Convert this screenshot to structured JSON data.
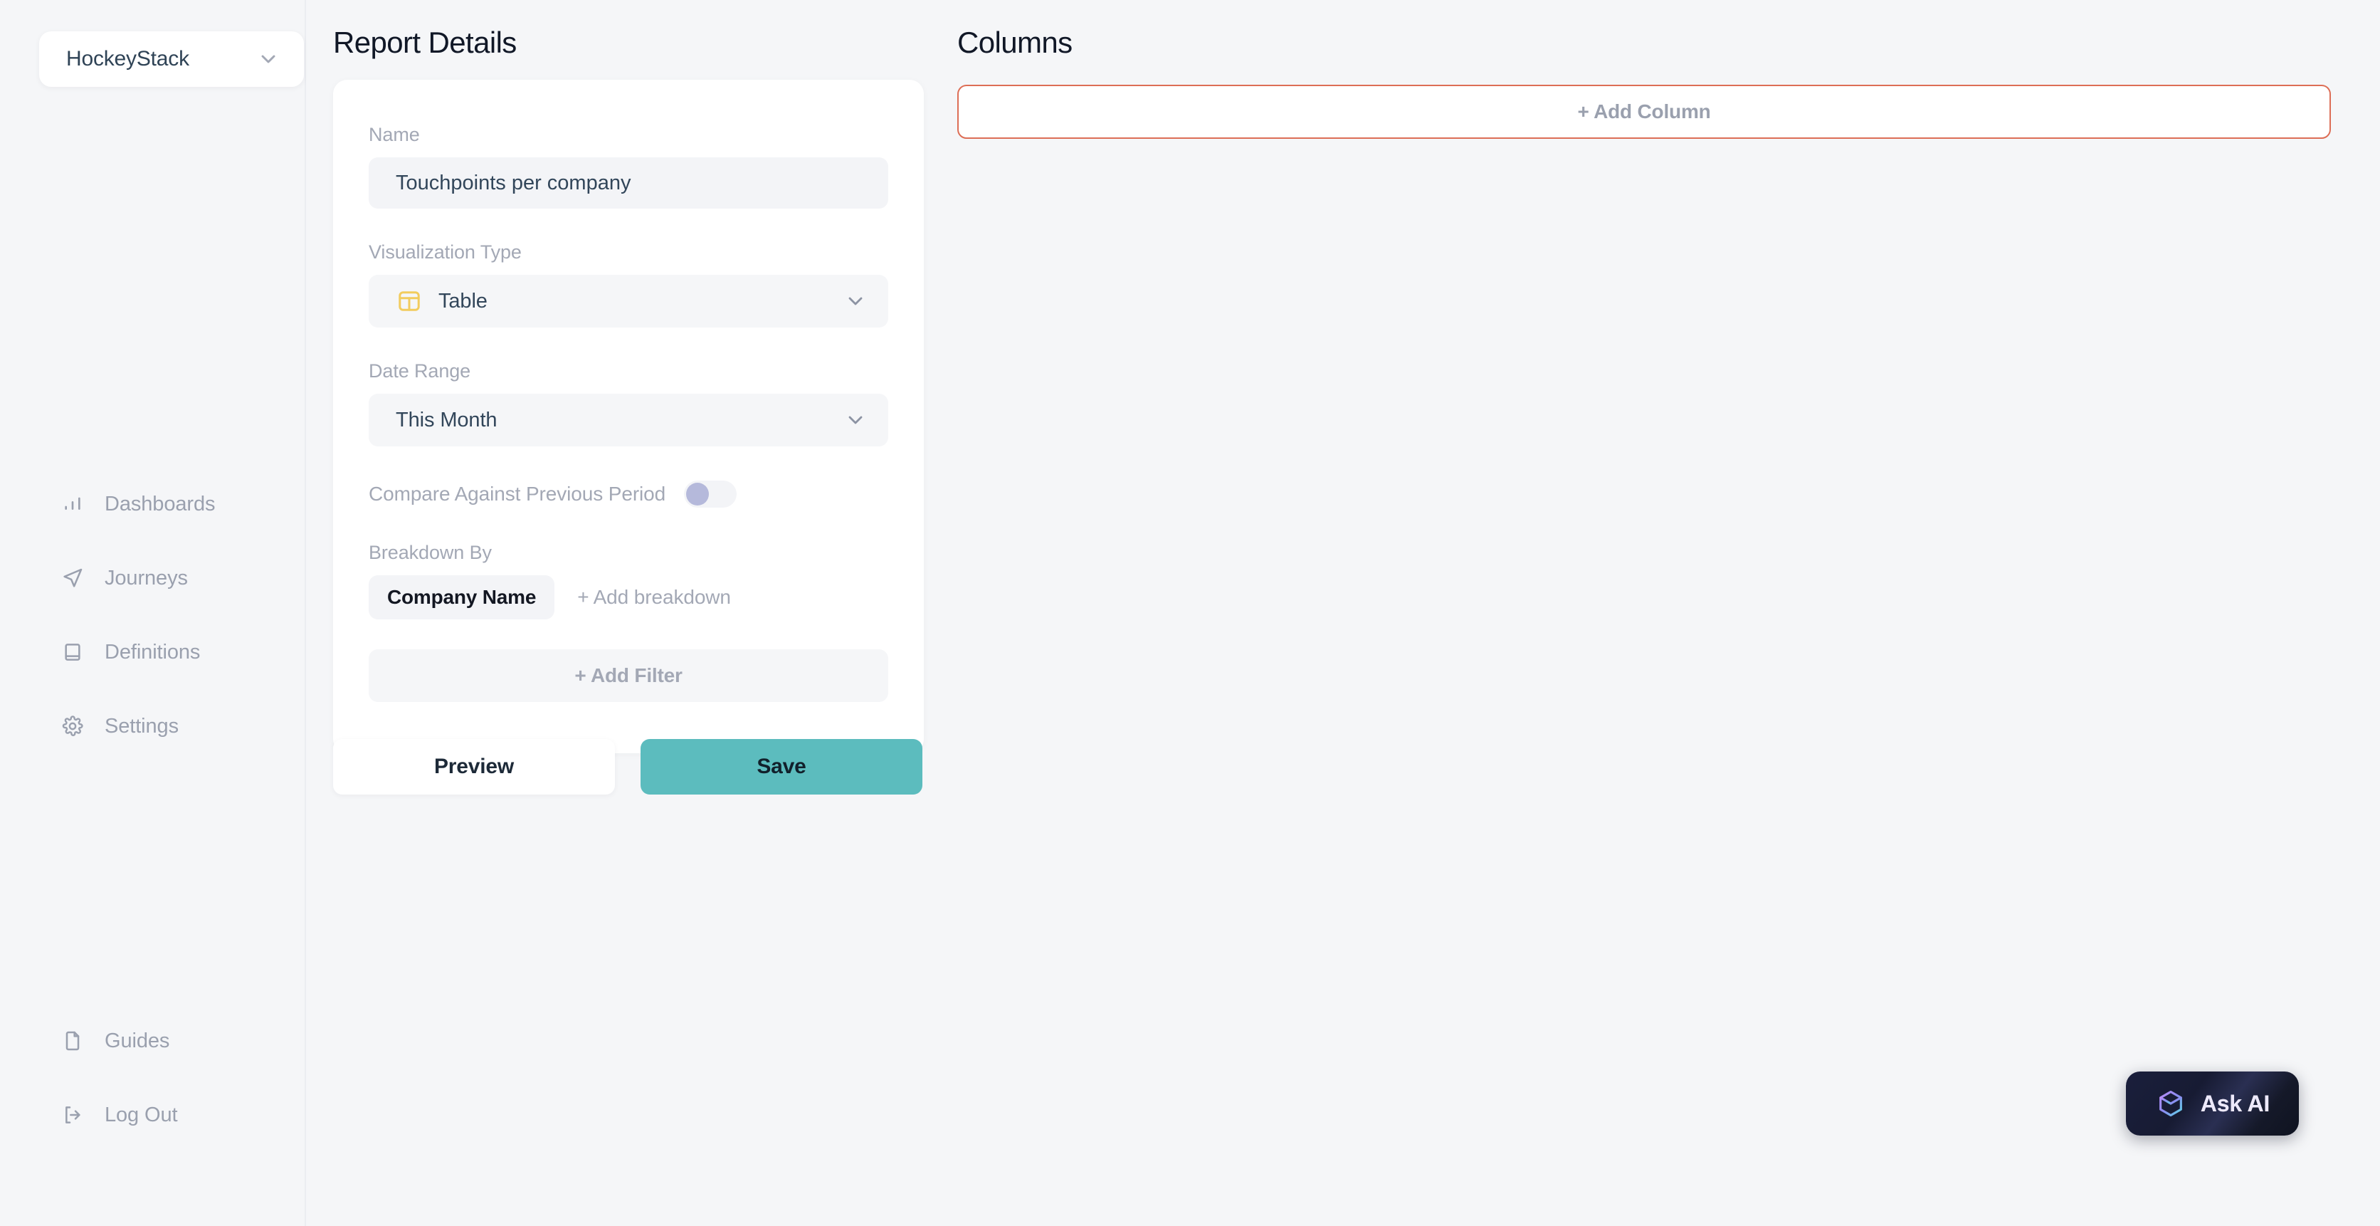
{
  "sidebar": {
    "workspace": {
      "name": "HockeyStack",
      "chevron_icon": "chevron-down-icon"
    },
    "main_items": [
      {
        "label": "Dashboards",
        "icon": "bar-chart-icon"
      },
      {
        "label": "Journeys",
        "icon": "navigation-arrow-icon"
      },
      {
        "label": "Definitions",
        "icon": "book-icon"
      },
      {
        "label": "Settings",
        "icon": "gear-icon"
      }
    ],
    "bottom_items": [
      {
        "label": "Guides",
        "icon": "file-icon"
      },
      {
        "label": "Log Out",
        "icon": "logout-icon"
      }
    ]
  },
  "details": {
    "title": "Report Details",
    "name": {
      "label": "Name",
      "value": "Touchpoints per company",
      "placeholder": "Report name"
    },
    "visualization": {
      "label": "Visualization Type",
      "value": "Table",
      "icon": "table-icon",
      "icon_color": "#F2CC5E",
      "chevron_icon": "chevron-down-icon"
    },
    "date_range": {
      "label": "Date Range",
      "value": "This Month",
      "chevron_icon": "chevron-down-icon"
    },
    "compare": {
      "label": "Compare Against Previous Period",
      "enabled": false,
      "knob_color": "#B5B9DB",
      "track_color": "#F3F4F7"
    },
    "breakdown": {
      "label": "Breakdown By",
      "chips": [
        "Company Name"
      ],
      "add_label": "+ Add breakdown"
    },
    "add_filter_label": "+ Add Filter",
    "buttons": {
      "preview": "Preview",
      "save": "Save",
      "save_color": "#5CBCBE"
    }
  },
  "columns": {
    "title": "Columns",
    "add_column_label": "+ Add Column",
    "add_column_border_color": "#DD6E56"
  },
  "ask_ai": {
    "label": "Ask AI",
    "icon": "cube-hexagon-icon"
  }
}
